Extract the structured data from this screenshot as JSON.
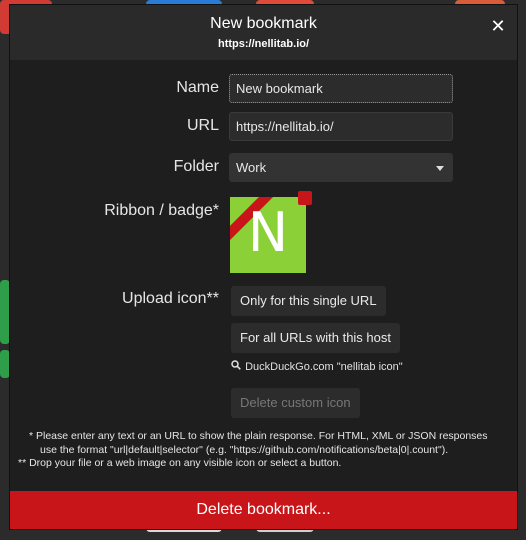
{
  "dialog": {
    "title": "New bookmark",
    "url": "https://nellitab.io/",
    "close_icon": "close-icon"
  },
  "form": {
    "name_label": "Name",
    "name_value": "New bookmark",
    "url_label": "URL",
    "url_value": "https://nellitab.io/",
    "folder_label": "Folder",
    "folder_value": "Work",
    "ribbon_label": "Ribbon / badge*",
    "badge_letter": "N",
    "badge_color": "#8bd037",
    "ribbon_color": "#c8151a",
    "upload_label": "Upload icon**"
  },
  "buttons": {
    "single_url": "Only for this single URL",
    "all_urls": "For all URLs with this host",
    "search_link": "DuckDuckGo.com \"nellitab icon\"",
    "delete_custom": "Delete custom icon"
  },
  "notes": {
    "line1": "* Please enter any text or an URL to show the plain response. For HTML, XML or JSON responses",
    "line2": "use the format \"url|default|selector\" (e.g. \"https://github.com/notifications/beta|0|.count\").",
    "line3": "** Drop your file or a web image on any visible icon or select a button."
  },
  "footer": {
    "delete_label": "Delete bookmark..."
  },
  "colors": {
    "accent_red": "#c8151a",
    "dialog_bg": "#1e1e1e",
    "header_bg": "#2a2a2a"
  }
}
